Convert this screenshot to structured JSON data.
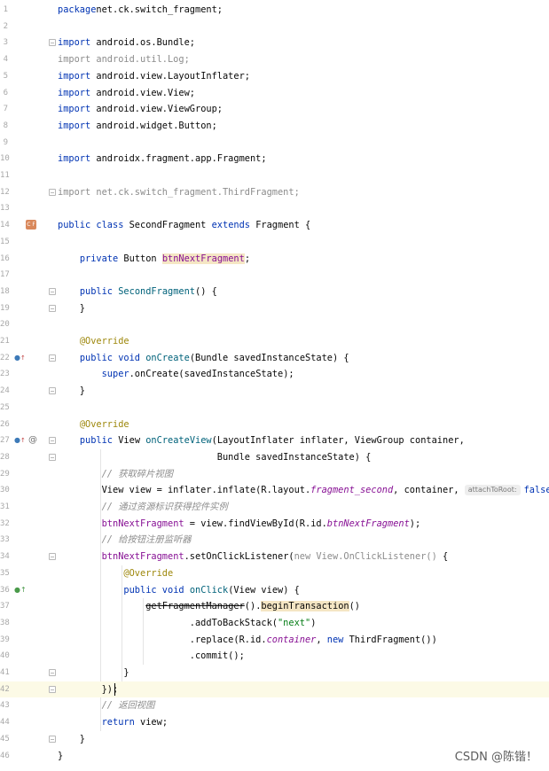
{
  "editor": {
    "lines": [
      {
        "n": "1",
        "segs": [
          [
            "kw",
            "package"
          ],
          [
            "",
            "net.ck.switch_fragment;"
          ]
        ]
      },
      {
        "n": "2",
        "segs": []
      },
      {
        "n": "3",
        "segs": [
          [
            "kw",
            "import"
          ],
          [
            "",
            " android.os.Bundle;"
          ]
        ]
      },
      {
        "n": "4",
        "segs": [
          [
            "dim",
            "import android.util.Log;"
          ]
        ]
      },
      {
        "n": "5",
        "segs": [
          [
            "kw",
            "import"
          ],
          [
            "",
            " android.view.LayoutInflater;"
          ]
        ]
      },
      {
        "n": "6",
        "segs": [
          [
            "kw",
            "import"
          ],
          [
            "",
            " android.view.View;"
          ]
        ]
      },
      {
        "n": "7",
        "segs": [
          [
            "kw",
            "import"
          ],
          [
            "",
            " android.view.ViewGroup;"
          ]
        ]
      },
      {
        "n": "8",
        "segs": [
          [
            "kw",
            "import"
          ],
          [
            "",
            " android.widget.Button;"
          ]
        ]
      },
      {
        "n": "9",
        "segs": []
      },
      {
        "n": "10",
        "segs": [
          [
            "kw",
            "import"
          ],
          [
            "",
            " androidx.fragment.app.Fragment;"
          ]
        ]
      },
      {
        "n": "11",
        "segs": []
      },
      {
        "n": "12",
        "segs": [
          [
            "dim",
            "import net.ck.switch_fragment.ThirdFragment;"
          ]
        ]
      },
      {
        "n": "13",
        "segs": []
      },
      {
        "n": "14",
        "segs": [
          [
            "kw",
            "public class "
          ],
          [
            "",
            "SecondFragment "
          ],
          [
            "kw",
            "extends "
          ],
          [
            "",
            "Fragment {"
          ]
        ]
      },
      {
        "n": "15",
        "segs": []
      },
      {
        "n": "16",
        "segs": [
          [
            "",
            "    "
          ],
          [
            "kw",
            "private "
          ],
          [
            "",
            "Button "
          ],
          [
            "fvar hl",
            "btnNextFragment"
          ],
          [
            "",
            ";"
          ]
        ]
      },
      {
        "n": "17",
        "segs": []
      },
      {
        "n": "18",
        "segs": [
          [
            "",
            "    "
          ],
          [
            "kw",
            "public "
          ],
          [
            "mdecl",
            "SecondFragment"
          ],
          [
            "",
            "() {"
          ]
        ]
      },
      {
        "n": "19",
        "segs": [
          [
            "",
            "    }"
          ]
        ]
      },
      {
        "n": "20",
        "segs": []
      },
      {
        "n": "21",
        "segs": [
          [
            "",
            "    "
          ],
          [
            "ann",
            "@Override"
          ]
        ]
      },
      {
        "n": "22",
        "segs": [
          [
            "",
            "    "
          ],
          [
            "kw",
            "public void "
          ],
          [
            "mdecl",
            "onCreate"
          ],
          [
            "",
            "(Bundle savedInstanceState) {"
          ]
        ]
      },
      {
        "n": "23",
        "segs": [
          [
            "",
            "        "
          ],
          [
            "kw",
            "super"
          ],
          [
            "",
            ".onCreate(savedInstanceState);"
          ]
        ]
      },
      {
        "n": "24",
        "segs": [
          [
            "",
            "    }"
          ]
        ]
      },
      {
        "n": "25",
        "segs": []
      },
      {
        "n": "26",
        "segs": [
          [
            "",
            "    "
          ],
          [
            "ann",
            "@Override"
          ]
        ]
      },
      {
        "n": "27",
        "segs": [
          [
            "",
            "    "
          ],
          [
            "kw",
            "public "
          ],
          [
            "",
            "View "
          ],
          [
            "mdecl",
            "onCreateView"
          ],
          [
            "",
            "(LayoutInflater inflater, ViewGroup container,"
          ]
        ]
      },
      {
        "n": "28",
        "segs": [
          [
            "",
            "                             Bundle savedInstanceState) {"
          ]
        ]
      },
      {
        "n": "29",
        "segs": [
          [
            "",
            "        "
          ],
          [
            "cmt",
            "// 获取碎片视图"
          ]
        ]
      },
      {
        "n": "30",
        "segs": [
          [
            "",
            "        View view = inflater.inflate(R.layout."
          ],
          [
            "fld",
            "fragment_second"
          ],
          [
            "",
            ", container, "
          ],
          [
            "hint",
            "attachToRoot:"
          ],
          [
            "kw",
            "false"
          ],
          [
            "",
            ");"
          ]
        ]
      },
      {
        "n": "31",
        "segs": [
          [
            "",
            "        "
          ],
          [
            "cmt",
            "// 通过资源标识获得控件实例"
          ]
        ]
      },
      {
        "n": "32",
        "segs": [
          [
            "",
            "        "
          ],
          [
            "fvar",
            "btnNextFragment"
          ],
          [
            "",
            " = view.findViewById(R.id."
          ],
          [
            "fld",
            "btnNextFragment"
          ],
          [
            "",
            ");"
          ]
        ]
      },
      {
        "n": "33",
        "segs": [
          [
            "",
            "        "
          ],
          [
            "cmt",
            "// 给按钮注册监听器"
          ]
        ]
      },
      {
        "n": "34",
        "segs": [
          [
            "",
            "        "
          ],
          [
            "fvar",
            "btnNextFragment"
          ],
          [
            "",
            ".setOnClickListener("
          ],
          [
            "dim",
            "new View.OnClickListener() "
          ],
          [
            "",
            "{"
          ]
        ]
      },
      {
        "n": "35",
        "segs": [
          [
            "",
            "            "
          ],
          [
            "ann",
            "@Override"
          ]
        ]
      },
      {
        "n": "36",
        "segs": [
          [
            "",
            "            "
          ],
          [
            "kw",
            "public void "
          ],
          [
            "mdecl",
            "onClick"
          ],
          [
            "",
            "(View view) {"
          ]
        ]
      },
      {
        "n": "37",
        "segs": [
          [
            "",
            "                "
          ],
          [
            "strike",
            "getFragmentManager"
          ],
          [
            "",
            "()."
          ],
          [
            "hl",
            "beginTransaction"
          ],
          [
            "",
            "()"
          ]
        ]
      },
      {
        "n": "38",
        "segs": [
          [
            "",
            "                        .addToBackStack("
          ],
          [
            "str",
            "\"next\""
          ],
          [
            "",
            ")"
          ]
        ]
      },
      {
        "n": "39",
        "segs": [
          [
            "",
            "                        .replace(R.id."
          ],
          [
            "fld",
            "container"
          ],
          [
            "",
            ", "
          ],
          [
            "kw",
            "new "
          ],
          [
            "",
            "ThirdFragment())"
          ]
        ]
      },
      {
        "n": "40",
        "segs": [
          [
            "",
            "                        .commit();"
          ]
        ]
      },
      {
        "n": "41",
        "segs": [
          [
            "",
            "            }"
          ]
        ]
      },
      {
        "n": "42",
        "segs": [
          [
            "",
            "        });"
          ]
        ]
      },
      {
        "n": "43",
        "segs": [
          [
            "",
            "        "
          ],
          [
            "cmt",
            "// 返回视图"
          ]
        ]
      },
      {
        "n": "44",
        "segs": [
          [
            "",
            "        "
          ],
          [
            "kw",
            "return "
          ],
          [
            "",
            "view;"
          ]
        ]
      },
      {
        "n": "45",
        "segs": [
          [
            "",
            "    }"
          ]
        ]
      },
      {
        "n": "46",
        "segs": [
          [
            "",
            "}"
          ]
        ]
      }
    ],
    "current_line": "42",
    "gutter_icons": [
      {
        "line": "14",
        "icon": "class-icon",
        "label": "C F"
      },
      {
        "line": "22",
        "icon": "implements-icon",
        "label": "o↑"
      },
      {
        "line": "27",
        "icon": "implements-icon",
        "label": "o↑"
      },
      {
        "line": "27",
        "icon": "at-icon",
        "label": "@"
      },
      {
        "line": "36",
        "icon": "override-icon",
        "label": "o↑"
      }
    ],
    "fold_lines": [
      "3",
      "12",
      "18",
      "19",
      "22",
      "24",
      "27",
      "28",
      "34",
      "41",
      "42",
      "45"
    ]
  },
  "watermark": "CSDN @陈锴！"
}
